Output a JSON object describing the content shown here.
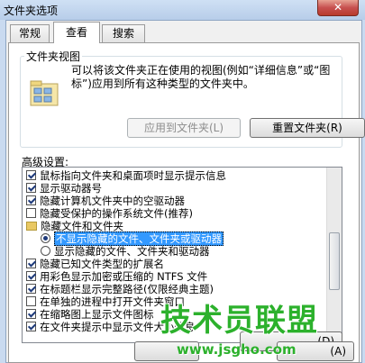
{
  "window": {
    "title": "文件夹选项",
    "close_glyph": "✕"
  },
  "tabs": [
    {
      "label": "常规"
    },
    {
      "label": "查看"
    },
    {
      "label": "搜索"
    }
  ],
  "folder_view": {
    "legend": "文件夹视图",
    "description": "可以将该文件夹正在使用的视图(例如“详细信息”或“图标”)应用到所有这种类型的文件夹中。",
    "apply_button": "应用到文件夹(L)",
    "reset_button": "重置文件夹(R)"
  },
  "advanced": {
    "label": "高级设置:",
    "items": [
      {
        "text": "鼠标指向文件夹和桌面项时显示提示信息",
        "kind": "checkbox",
        "checked": true
      },
      {
        "text": "显示驱动器号",
        "kind": "checkbox",
        "checked": true
      },
      {
        "text": "隐藏计算机文件夹中的空驱动器",
        "kind": "checkbox",
        "checked": true
      },
      {
        "text": "隐藏受保护的操作系统文件(推荐)",
        "kind": "checkbox",
        "checked": false
      },
      {
        "text": "隐藏文件和文件夹",
        "kind": "folder"
      },
      {
        "text": "不显示隐藏的文件、文件夹或驱动器",
        "kind": "radio",
        "checked": true,
        "selected": true
      },
      {
        "text": "显示隐藏的文件、文件夹和驱动器",
        "kind": "radio",
        "checked": false
      },
      {
        "text": "隐藏已知文件类型的扩展名",
        "kind": "checkbox",
        "checked": true
      },
      {
        "text": "用彩色显示加密或压缩的 NTFS 文件",
        "kind": "checkbox",
        "checked": true
      },
      {
        "text": "在标题栏显示完整路径(仅限经典主题)",
        "kind": "checkbox",
        "checked": true
      },
      {
        "text": "在单独的进程中打开文件夹窗口",
        "kind": "checkbox",
        "checked": false
      },
      {
        "text": "在缩略图上显示文件图标",
        "kind": "checkbox",
        "checked": true
      },
      {
        "text": "在文件夹提示中显示文件大小信息",
        "kind": "checkbox",
        "checked": true
      }
    ]
  },
  "buttons": {
    "restore_partial": "(D)",
    "bottom_partial": "(A)"
  },
  "watermark": {
    "main": "技术员联盟",
    "url": "www.jsgho.com"
  },
  "colors": {
    "selection": "#3399ff",
    "watermark": "#2cb12c"
  }
}
